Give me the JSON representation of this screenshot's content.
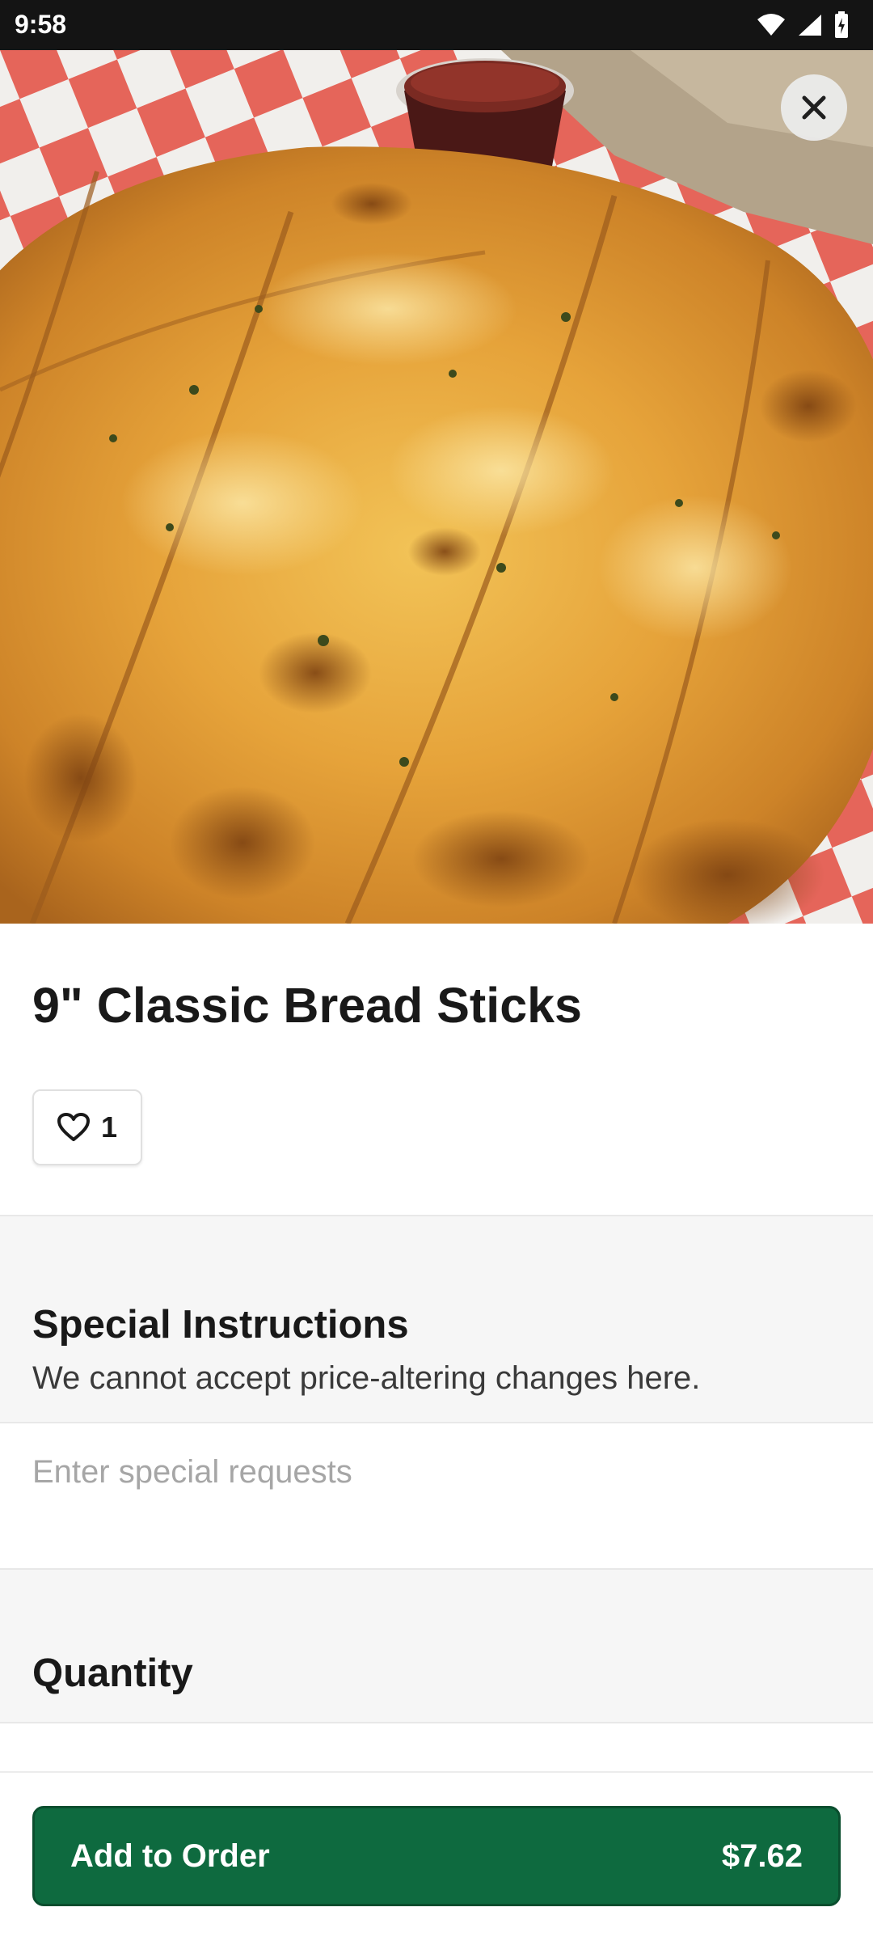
{
  "status_bar": {
    "time": "9:58",
    "icons": [
      "wifi-icon",
      "signal-icon",
      "battery-icon"
    ]
  },
  "hero": {
    "image": "bread-sticks-photo",
    "close_icon": "close-icon"
  },
  "item": {
    "title": "9\" Classic Bread Sticks",
    "favorite_count": "1",
    "favorite_icon": "heart-icon"
  },
  "special_instructions": {
    "heading": "Special Instructions",
    "subtitle": "We cannot accept price-altering changes here.",
    "input_value": "",
    "input_placeholder": "Enter special requests"
  },
  "quantity": {
    "heading": "Quantity"
  },
  "footer": {
    "add_label": "Add to Order",
    "price": "$7.62"
  },
  "colors": {
    "brand_green": "#0e6a3f",
    "section_gray": "#f6f6f6",
    "placeholder_gray": "#a6a6a6"
  }
}
